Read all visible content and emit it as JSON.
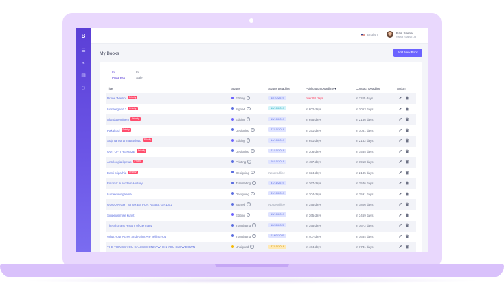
{
  "app": {
    "logo_letter": "B",
    "language": "English",
    "user_name": "Rain Sierner",
    "user_company": "Rahva Raamat Ltd"
  },
  "sidebar": {
    "items": [
      {
        "icon": "list-icon"
      },
      {
        "icon": "tag-icon"
      },
      {
        "icon": "book-icon"
      },
      {
        "icon": "users-icon"
      }
    ]
  },
  "page": {
    "title": "My Books",
    "add_button": "Add New Book"
  },
  "tabs": [
    {
      "label": "In Progress",
      "active": true
    },
    {
      "label": "In Sale",
      "active": false
    }
  ],
  "table": {
    "columns": [
      "Title",
      "Status",
      "Status Deadline",
      "Publication Deadline",
      "Contract Deadline",
      "Action"
    ],
    "sort_indicator": "▾",
    "priority_label": "Priority",
    "rows": [
      {
        "title": "Drone Warrior",
        "priority": true,
        "status": "Editing",
        "status_color": "#6c63ff",
        "deadline": "11/10/2019",
        "deadline_style": "blue",
        "publication": "over 94 days",
        "pub_overdue": true,
        "contract": "in 1185 days"
      },
      {
        "title": "Linnalegend 2",
        "priority": true,
        "status": "Signed",
        "status_color": "#5b6ee0",
        "deadline": "10/10/2019",
        "deadline_style": "cyan",
        "publication": "in 602 days",
        "pub_overdue": false,
        "contract": "in 2063 days"
      },
      {
        "title": "Alanduseminem",
        "priority": true,
        "status": "Editing",
        "status_color": "#6c63ff",
        "deadline": "13/10/2019",
        "deadline_style": "blue",
        "publication": "in 695 days",
        "pub_overdue": false,
        "contract": "in 2156 days"
      },
      {
        "title": "Pakukool",
        "priority": true,
        "status": "Designing",
        "status_color": "#5b6ee0",
        "deadline": "27/10/2019",
        "deadline_style": "blue",
        "publication": "in 351 days",
        "pub_overdue": false,
        "contract": "in 1081 days"
      },
      {
        "title": "Suja rahva armastusload",
        "priority": true,
        "status": "Editing",
        "status_color": "#6c63ff",
        "deadline": "14/10/2019",
        "deadline_style": "blue",
        "publication": "in 691 days",
        "pub_overdue": false,
        "contract": "in 2152 days"
      },
      {
        "title": "OUT OF THE MAZE",
        "priority": true,
        "status": "Designing",
        "status_color": "#5b6ee0",
        "deadline": "21/10/2019",
        "deadline_style": "blue",
        "publication": "in 306 days",
        "pub_overdue": false,
        "contract": "in 1565 days"
      },
      {
        "title": "Antoloogia ilpetus",
        "priority": true,
        "status": "Printing",
        "status_color": "#5b6ee0",
        "deadline": "08/10/2019",
        "deadline_style": "blue",
        "publication": "in 457 days",
        "pub_overdue": false,
        "contract": "in 1918 days"
      },
      {
        "title": "Eesti oligarhia",
        "priority": true,
        "status": "Designing",
        "status_color": "#5b6ee0",
        "deadline": "No deadline",
        "deadline_style": "none",
        "publication": "in 724 days",
        "pub_overdue": false,
        "contract": "in 2185 days"
      },
      {
        "title": "Estonia: A Modern History",
        "priority": false,
        "status": "Translating",
        "status_color": "#5b6ee0",
        "deadline": "31/11/2019",
        "deadline_style": "blue",
        "publication": "in 267 days",
        "pub_overdue": false,
        "contract": "in 1546 days"
      },
      {
        "title": "Lumekuningaema",
        "priority": false,
        "status": "Designing",
        "status_color": "#5b6ee0",
        "deadline": "31/10/2019",
        "deadline_style": "blue",
        "publication": "in 304 days",
        "pub_overdue": false,
        "contract": "in 3591 days"
      },
      {
        "title": "GOOD NIGHT STORIES FOR REBEL GIRLS 2",
        "priority": false,
        "status": "Signed",
        "status_color": "#5b6ee0",
        "deadline": "No deadline",
        "deadline_style": "none",
        "publication": "in 345 days",
        "pub_overdue": false,
        "contract": "in 1806 days"
      },
      {
        "title": "Siilipeidemise kunst",
        "priority": false,
        "status": "Editing",
        "status_color": "#6c63ff",
        "deadline": "13/10/2019",
        "deadline_style": "blue",
        "publication": "in 365 days",
        "pub_overdue": false,
        "contract": "in 3469 days"
      },
      {
        "title": "The Shortest History of Germany",
        "priority": false,
        "status": "Translating",
        "status_color": "#5b6ee0",
        "deadline": "12/01/2020",
        "deadline_style": "blue",
        "publication": "in 395 days",
        "pub_overdue": false,
        "contract": "in 1672 days"
      },
      {
        "title": "What Your Aches and Pains Are Telling You",
        "priority": false,
        "status": "Translating",
        "status_color": "#5b6ee0",
        "deadline": "01/03/2020",
        "deadline_style": "blue",
        "publication": "in 407 days",
        "pub_overdue": false,
        "contract": "in 1684 days"
      },
      {
        "title": "THE THINGS YOU CAN SEE ONLY WHEN YOU SLOW DOWN",
        "priority": false,
        "status": "Unsigned",
        "status_color": "#f5b800",
        "deadline": "27/10/2019",
        "deadline_style": "amber",
        "publication": "in 464 days",
        "pub_overdue": false,
        "contract": "in 1741 days"
      }
    ]
  }
}
